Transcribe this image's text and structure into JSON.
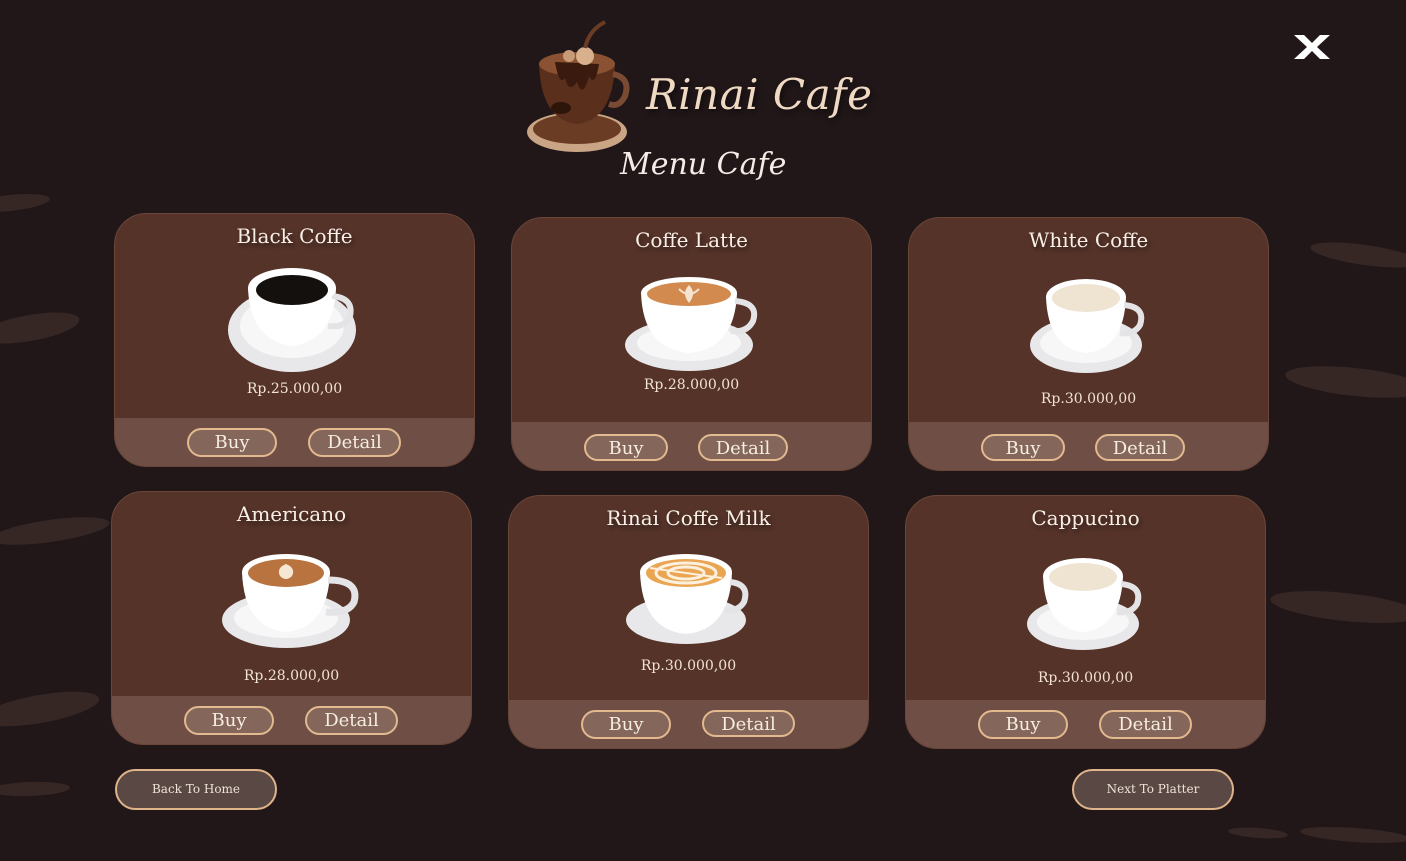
{
  "brand": {
    "name": "Rinai Cafe",
    "subtitle": "Menu Cafe"
  },
  "window": {
    "close_icon": "close-x-icon"
  },
  "menu": [
    {
      "name": "Black Coffe",
      "price": "Rp.25.000,00",
      "buy_label": "Buy",
      "detail_label": "Detail",
      "cup": "black-coffee-cup-icon"
    },
    {
      "name": "Coffe Latte",
      "price": "Rp.28.000,00",
      "buy_label": "Buy",
      "detail_label": "Detail",
      "cup": "latte-cup-icon"
    },
    {
      "name": "White Coffe",
      "price": "Rp.30.000,00",
      "buy_label": "Buy",
      "detail_label": "Detail",
      "cup": "white-coffee-cup-icon"
    },
    {
      "name": "Americano",
      "price": "Rp.28.000,00",
      "buy_label": "Buy",
      "detail_label": "Detail",
      "cup": "americano-cup-icon"
    },
    {
      "name": "Rinai Coffe Milk",
      "price": "Rp.30.000,00",
      "buy_label": "Buy",
      "detail_label": "Detail",
      "cup": "caramel-milk-cup-icon"
    },
    {
      "name": "Cappucino",
      "price": "Rp.30.000,00",
      "buy_label": "Buy",
      "detail_label": "Detail",
      "cup": "cappuccino-cup-icon"
    }
  ],
  "nav": {
    "back_label": "Back To Home",
    "next_label": "Next To Platter"
  },
  "colors": {
    "background": "#211719",
    "card": "#553329",
    "card_footer": "#6f4f45",
    "button_border": "#e3b98f"
  }
}
